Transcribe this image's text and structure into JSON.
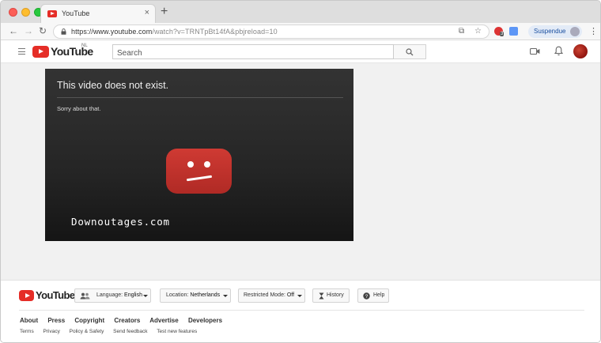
{
  "browser": {
    "tab_title": "YouTube",
    "url_host": "https://www.youtube.com",
    "url_path": "/watch?v=TRNTpBt14fA&pbjreload=10",
    "extension_badge": "3",
    "profile_label": "Suspendue"
  },
  "header": {
    "logo_text": "YouTube",
    "region": "NL",
    "search_placeholder": "Search"
  },
  "player": {
    "title": "This video does not exist.",
    "subtitle": "Sorry about that.",
    "watermark": "Downoutages.com"
  },
  "footer": {
    "logo_text": "YouTube",
    "language_prefix": "Language: ",
    "language_value": "English",
    "location_prefix": "Location: ",
    "location_value": "Netherlands",
    "restricted_prefix": "Restricted Mode: ",
    "restricted_value": "Off",
    "history_label": "History",
    "help_label": "Help",
    "links": [
      "About",
      "Press",
      "Copyright",
      "Creators",
      "Advertise",
      "Developers"
    ],
    "sublinks": [
      "Terms",
      "Privacy",
      "Policy & Safety",
      "Send feedback",
      "Test new features"
    ]
  },
  "colors": {
    "youtube_red": "#e52d27",
    "error_icon_red": "#c4302b",
    "player_bg": "#252525"
  }
}
